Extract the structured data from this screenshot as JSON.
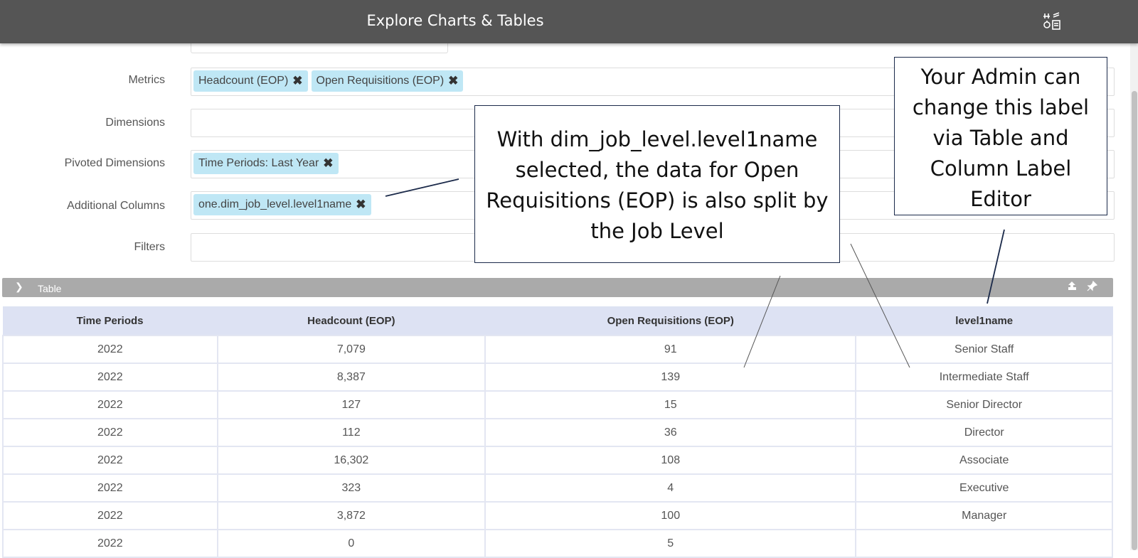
{
  "app": {
    "title": "Explore Charts & Tables",
    "tool_icon": "settings-adjust-icon"
  },
  "form": {
    "metrics_label": "Metrics",
    "metrics_chips": [
      "Headcount (EOP)",
      "Open Requisitions (EOP)"
    ],
    "dimensions_label": "Dimensions",
    "pivoted_label": "Pivoted Dimensions",
    "pivoted_chips": [
      "Time Periods: Last Year"
    ],
    "additional_label": "Additional Columns",
    "additional_chips": [
      "one.dim_job_level.level1name"
    ],
    "filters_label": "Filters",
    "remove_icon": "close-icon"
  },
  "panel": {
    "title": "Table",
    "icons": [
      "export-icon",
      "pin-icon"
    ]
  },
  "table": {
    "headers": [
      "Time Periods",
      "Headcount (EOP)",
      "Open Requisitions (EOP)",
      "level1name"
    ],
    "rows": [
      [
        "2022",
        "7,079",
        "91",
        "Senior Staff"
      ],
      [
        "2022",
        "8,387",
        "139",
        "Intermediate Staff"
      ],
      [
        "2022",
        "127",
        "15",
        "Senior Director"
      ],
      [
        "2022",
        "112",
        "36",
        "Director"
      ],
      [
        "2022",
        "16,302",
        "108",
        "Associate"
      ],
      [
        "2022",
        "323",
        "4",
        "Executive"
      ],
      [
        "2022",
        "3,872",
        "100",
        "Manager"
      ],
      [
        "2022",
        "0",
        "5",
        ""
      ]
    ]
  },
  "callouts": {
    "main": [
      "With dim_job_level.level1name",
      "selected, the data for Open",
      "Requisitions (EOP) is also split by",
      "the Job Level"
    ],
    "admin": [
      "Your Admin can",
      "change this label",
      "via Table and",
      "Column Label",
      "Editor"
    ]
  },
  "colors": {
    "topbar": "#555555",
    "chip": "#bfe7f5",
    "table_header": "#dde2f3",
    "panel_bar": "#aaaaaa"
  }
}
